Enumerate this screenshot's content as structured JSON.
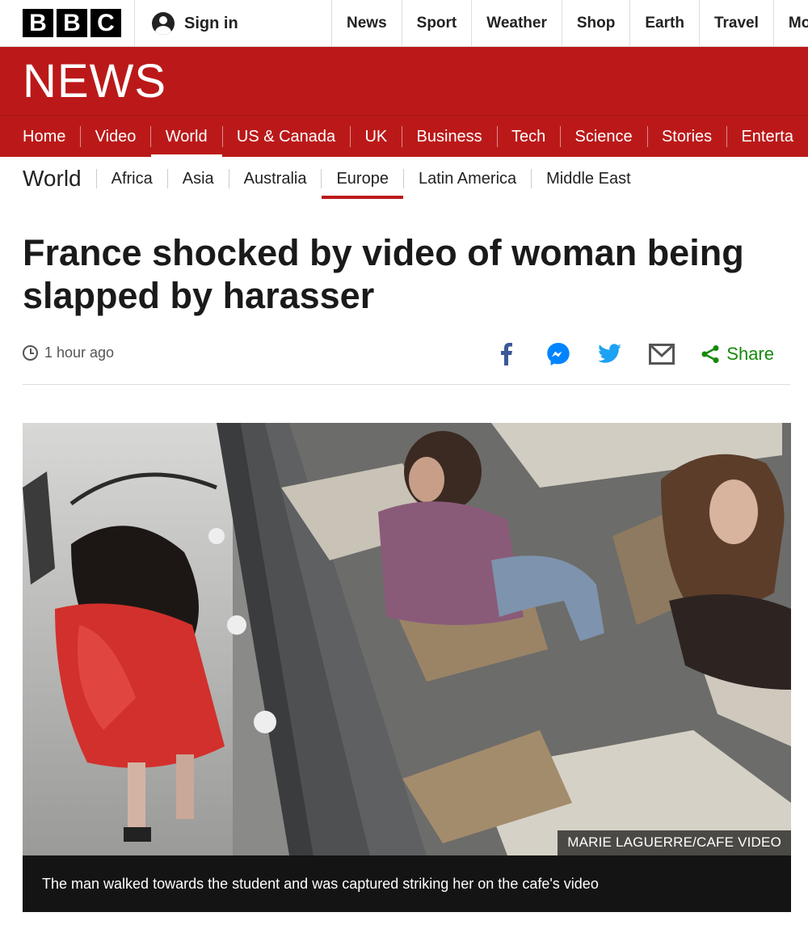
{
  "topbar": {
    "logo_letters": [
      "B",
      "B",
      "C"
    ],
    "signin_label": "Sign in",
    "nav": [
      "News",
      "Sport",
      "Weather",
      "Shop",
      "Earth",
      "Travel",
      "Mo"
    ]
  },
  "banner": {
    "wordmark": "NEWS",
    "color": "#bb1919"
  },
  "red_nav": {
    "items": [
      "Home",
      "Video",
      "World",
      "US & Canada",
      "UK",
      "Business",
      "Tech",
      "Science",
      "Stories",
      "Enterta"
    ],
    "active": "World"
  },
  "section_nav": {
    "title": "World",
    "items": [
      "Africa",
      "Asia",
      "Australia",
      "Europe",
      "Latin America",
      "Middle East"
    ],
    "active": "Europe"
  },
  "article": {
    "headline": "France shocked by video of woman being slapped by harasser",
    "timestamp": "1 hour ago",
    "share_label": "Share",
    "share_icons": [
      "facebook-icon",
      "messenger-icon",
      "twitter-icon",
      "email-icon",
      "share-icon"
    ],
    "image": {
      "credit": "MARIE LAGUERRE/CAFE VIDEO",
      "caption": "The man walked towards the student and was captured striking her on the cafe's video"
    }
  },
  "colors": {
    "brand_red": "#bb1919",
    "facebook": "#3b5998",
    "messenger": "#0084ff",
    "twitter": "#1da1f2",
    "share_green": "#158a0b"
  }
}
